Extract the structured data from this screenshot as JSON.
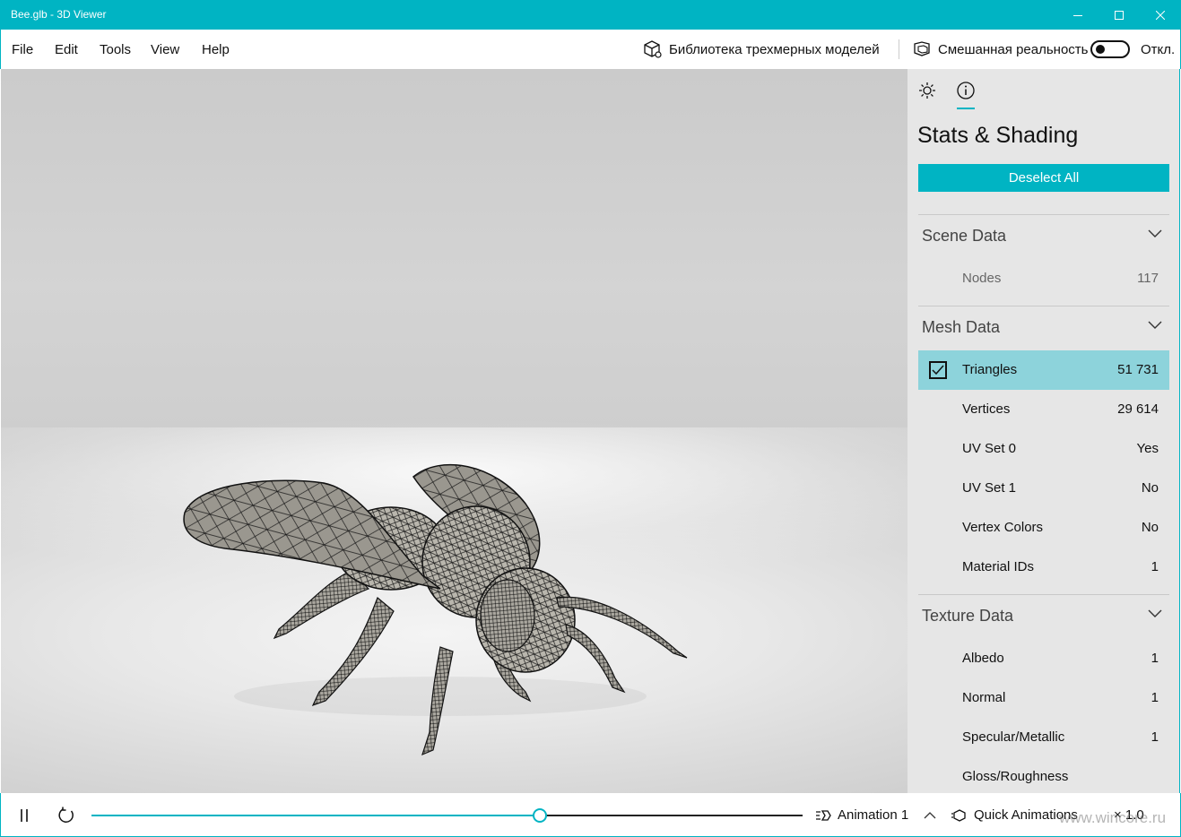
{
  "window": {
    "title": "Bee.glb - 3D Viewer",
    "accent_color": "#00b4c3"
  },
  "menu": {
    "items": [
      "File",
      "Edit",
      "Tools",
      "View",
      "Help"
    ],
    "library_label": "Библиотека трехмерных моделей",
    "mixed_reality_label": "Смешанная реальность",
    "mixed_reality_state": "Откл.",
    "mixed_reality_on": false
  },
  "panel": {
    "tabs": [
      "sun-icon",
      "info-icon"
    ],
    "active_tab": "info-icon",
    "title": "Stats & Shading",
    "deselect_label": "Deselect All",
    "scene": {
      "label": "Scene Data",
      "rows": [
        {
          "label": "Nodes",
          "value": "117"
        }
      ]
    },
    "mesh": {
      "label": "Mesh Data",
      "rows": [
        {
          "label": "Triangles",
          "value": "51 731",
          "checked": true
        },
        {
          "label": "Vertices",
          "value": "29 614"
        },
        {
          "label": "UV Set 0",
          "value": "Yes"
        },
        {
          "label": "UV Set 1",
          "value": "No"
        },
        {
          "label": "Vertex Colors",
          "value": "No"
        },
        {
          "label": "Material IDs",
          "value": "1"
        }
      ]
    },
    "texture": {
      "label": "Texture Data",
      "rows": [
        {
          "label": "Albedo",
          "value": "1"
        },
        {
          "label": "Normal",
          "value": "1"
        },
        {
          "label": "Specular/Metallic",
          "value": "1"
        },
        {
          "label": "Gloss/Roughness",
          "value": ""
        }
      ]
    }
  },
  "bottom": {
    "progress": 0.63,
    "animation_label": "Animation 1",
    "quick_label": "Quick Animations",
    "speed": "× 1.0",
    "watermark": "www.wincore.ru"
  }
}
